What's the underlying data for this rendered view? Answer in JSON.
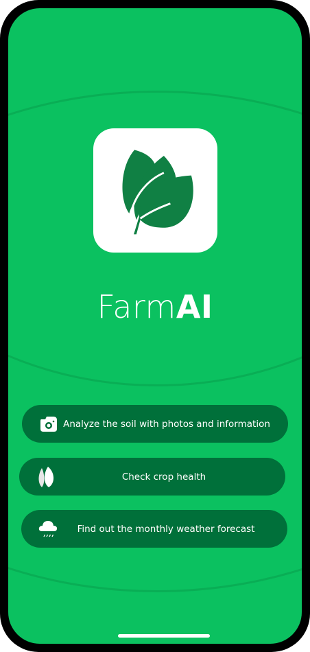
{
  "app": {
    "title_regular": "Farm",
    "title_bold": "AI",
    "logo_icon": "leaves-icon"
  },
  "colors": {
    "background": "#0bc160",
    "button": "#00703a",
    "logo_leaf": "#108044"
  },
  "actions": [
    {
      "label": "Analyze the soil with photos and information",
      "icon": "camera-icon"
    },
    {
      "label": "Check crop health",
      "icon": "leaf-icon"
    },
    {
      "label": "Find out the monthly weather forecast",
      "icon": "rain-cloud-icon"
    }
  ]
}
